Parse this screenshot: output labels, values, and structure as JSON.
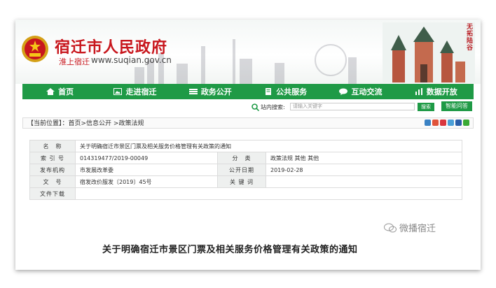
{
  "header": {
    "site_title": "宿迁市人民政府",
    "site_sub": "淮上宿迁",
    "site_url": "www.suqian.gov.cn",
    "slogan": "无拓陆谷"
  },
  "nav": {
    "items": [
      {
        "label": "首页",
        "icon": "home-icon"
      },
      {
        "label": "走进宿迁",
        "icon": "image-icon"
      },
      {
        "label": "政务公开",
        "icon": "list-icon"
      },
      {
        "label": "公共服务",
        "icon": "document-icon"
      },
      {
        "label": "互动交流",
        "icon": "chat-icon"
      },
      {
        "label": "数据开放",
        "icon": "chart-icon"
      }
    ]
  },
  "search": {
    "label": "站内搜索:",
    "placeholder": "请输入关键字",
    "button": "搜索",
    "qa_button": "智能问答"
  },
  "breadcrumb": {
    "text": "【当前位置】：首页>信息公开 >政策法规"
  },
  "info": {
    "name_label": "名　称",
    "name_value": "关于明确宿迁市景区门票及相关服务价格管理有关政策的通知",
    "index_label": "索 引 号",
    "index_value": "014319477/2019-00049",
    "category_label": "分　类",
    "category_value": "政策法规  其他  其他",
    "org_label": "发布机构",
    "org_value": "市发展改革委",
    "date_label": "公开日期",
    "date_value": "2019-02-28",
    "docno_label": "文　号",
    "docno_value": "宿发改价服发〔2019〕45号",
    "keyword_label": "关 键 词",
    "keyword_value": "",
    "download_label": "文件下载",
    "download_value": ""
  },
  "body": {
    "title": "关于明确宿迁市景区门票及相关服务价格管理有关政策的通知"
  },
  "watermark": "微播宿迁",
  "colors": {
    "brand_red": "#c8161d",
    "nav_green": "#1f9a46"
  }
}
